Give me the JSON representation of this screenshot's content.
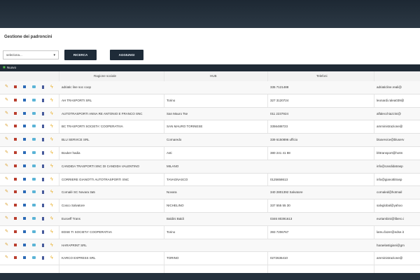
{
  "page": {
    "title": "Gestione dei padroncini"
  },
  "filters": {
    "select_value": "seleziona...",
    "search_label": "RICERCA",
    "add_label": "AGGIUNGI"
  },
  "table": {
    "bar_label": "Nuovo",
    "columns": [
      "Ragione sociale",
      "HUB",
      "Telefoni"
    ],
    "rows": [
      {
        "name": "adriatic line soc coop",
        "hub": "",
        "phone": "335 7121488",
        "email": "adriaticline.reali@"
      },
      {
        "name": "AH TRASPORTI SRL",
        "hub": "Torino",
        "phone": "327 3120724",
        "email": "leonardi.ralea039@"
      },
      {
        "name": "AUTOTRASPORTI ANNA RE ANTONIO E FRANCO SNC",
        "hub": "San Mauro Tse",
        "phone": "011 2237924",
        "email": "alfalecchiazzini@"
      },
      {
        "name": "BC TRASPORTI SOCIETA' COOPERATIVA",
        "hub": "SAN MAURO TORINESE",
        "phone": "3356488723",
        "email": "amministrazione@"
      },
      {
        "name": "BLU SERVICE SRL",
        "hub": "Cornaredo",
        "phone": "339 6150896 ufficio",
        "email": "bluservice@bluserv"
      },
      {
        "name": "Bouker hadia",
        "hub": "Asti",
        "phone": "380 241 41 88",
        "email": "bhtransport@hotm"
      },
      {
        "name": "CANDIDA TRASPORTI SNC DI CANDIDA VALENTINO",
        "hub": "MILANO",
        "phone": "",
        "email": "info@candidatrasp"
      },
      {
        "name": "CORRIERE GIANOTTI AUTOTRASPORTI SNC",
        "hub": "TAVAGNASCO",
        "phone": "0125658613",
        "email": "info@gianottitrasp"
      },
      {
        "name": "Cornalè SC Novara 3a5",
        "hub": "Novara",
        "phone": "340 2801392 Salvatore",
        "email": "cornaled@hotmail"
      },
      {
        "name": "Cosco Salvatore",
        "hub": "NICHELINO",
        "phone": "337 555 55 30",
        "email": "salvglobal@yahoo"
      },
      {
        "name": "Euroeff Trans",
        "hub": "Baldini Baldi",
        "phone": "0346 80391613",
        "email": "eurtambini@libero.i"
      },
      {
        "name": "EDSE TI SOCIETA' COOPERATIVA",
        "hub": "Torino",
        "phone": "393 7206767",
        "email": "lamu.fazer@edse.it"
      },
      {
        "name": "HARAPRINT SRL",
        "hub": "",
        "phone": "",
        "email": "haraelastigiani@gm"
      },
      {
        "name": "KARCO EXPRESS SRL",
        "hub": "TORINO",
        "phone": "0272636410",
        "email": "amministrazione@"
      }
    ]
  },
  "colors": {
    "dark_chrome": "#1f2a35",
    "edit_accent": "#d89a22",
    "add_accent": "#53c14b"
  },
  "icons": [
    "pencil-icon",
    "delete-icon",
    "document-icon",
    "user-icon",
    "trash-icon",
    "lightning-icon",
    "plus-icon",
    "chevron-down-icon"
  ]
}
